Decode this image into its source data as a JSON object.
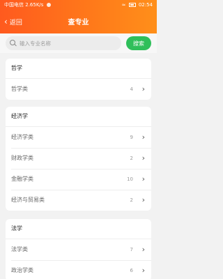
{
  "status_bar": {
    "carrier": "中国电信",
    "speed": "2.65K/s",
    "time": "02:54"
  },
  "nav": {
    "back_label": "返回",
    "title": "查专业"
  },
  "search": {
    "placeholder": "输入专业名称",
    "button_label": "搜索"
  },
  "groups": [
    {
      "title": "哲学",
      "items": [
        {
          "label": "哲学类",
          "count": "4"
        }
      ]
    },
    {
      "title": "经济学",
      "items": [
        {
          "label": "经济学类",
          "count": "9"
        },
        {
          "label": "财政学类",
          "count": "2"
        },
        {
          "label": "金融学类",
          "count": "10"
        },
        {
          "label": "经济与贸易类",
          "count": "2"
        }
      ]
    },
    {
      "title": "法学",
      "items": [
        {
          "label": "法学类",
          "count": "7"
        },
        {
          "label": "政治学类",
          "count": "6"
        }
      ]
    }
  ],
  "colors": {
    "header_start": "#ff5a1e",
    "header_end": "#ff8f1a",
    "search_button": "#2fbf5a"
  },
  "icons": {
    "back": "chevron-left-icon",
    "search": "search-icon",
    "row_arrow": "chevron-right-icon"
  }
}
